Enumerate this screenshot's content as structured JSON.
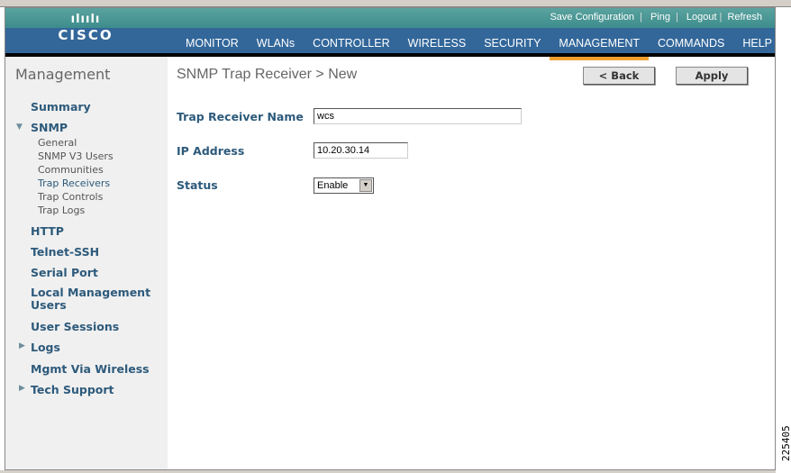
{
  "header": {
    "logo_bars": "ılıılı",
    "logo_text": "CISCO",
    "links": [
      "Save Configuration",
      "Ping",
      "Logout",
      "Refresh"
    ],
    "nav": [
      "MONITOR",
      "WLANs",
      "CONTROLLER",
      "WIRELESS",
      "SECURITY",
      "MANAGEMENT",
      "COMMANDS",
      "HELP"
    ],
    "active_nav": "MANAGEMENT"
  },
  "sidebar": {
    "title": "Management",
    "summary": "Summary",
    "snmp": "SNMP",
    "snmp_items": [
      "General",
      "SNMP V3 Users",
      "Communities",
      "Trap Receivers",
      "Trap Controls",
      "Trap Logs"
    ],
    "selected": "Trap Receivers",
    "items": [
      "HTTP",
      "Telnet-SSH",
      "Serial Port",
      "Local Management Users",
      "User Sessions",
      "Logs",
      "Mgmt Via Wireless",
      "Tech Support"
    ]
  },
  "main": {
    "title": "SNMP Trap Receiver > New",
    "back": "< Back",
    "apply": "Apply",
    "fields": {
      "name_label": "Trap Receiver Name",
      "name_value": "wcs",
      "ip_label": "IP Address",
      "ip_value": "10.20.30.14",
      "status_label": "Status",
      "status_value": "Enable"
    }
  },
  "figure_number": "225405"
}
